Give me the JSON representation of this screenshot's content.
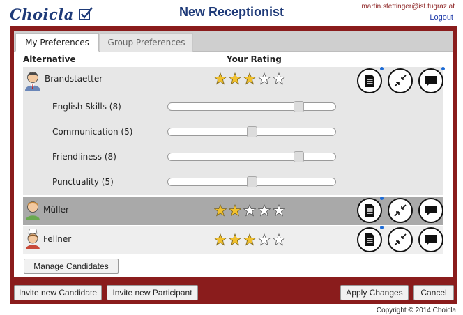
{
  "header": {
    "logo_text": "Choicla",
    "title": "New Receptionist",
    "user_email": "martin.stettinger@ist.tugraz.at",
    "logout_label": "Logout"
  },
  "tabs": [
    {
      "label": "My Preferences",
      "active": true
    },
    {
      "label": "Group Preferences",
      "active": false
    }
  ],
  "columns": {
    "alternative": "Alternative",
    "rating": "Your Rating"
  },
  "candidates": [
    {
      "name": "Brandstaetter",
      "rating": 3,
      "expanded": true
    },
    {
      "name": "Müller",
      "rating": 2,
      "selected": true
    },
    {
      "name": "Fellner",
      "rating": 3
    }
  ],
  "criteria": [
    {
      "label": "English Skills (8)",
      "value": 8
    },
    {
      "label": "Communication (5)",
      "value": 5
    },
    {
      "label": "Friendliness (8)",
      "value": 8
    },
    {
      "label": "Punctuality (5)",
      "value": 5
    }
  ],
  "buttons": {
    "manage_candidates": "Manage Candidates",
    "invite_candidate": "Invite new Candidate",
    "invite_participant": "Invite new Participant",
    "apply_changes": "Apply Changes",
    "cancel": "Cancel"
  },
  "footer": {
    "copyright": "Copyright © 2014 Choicla"
  },
  "colors": {
    "frame": "#8a1c1c",
    "title": "#1e3a78",
    "star_filled": "#f2c12e",
    "selected_row": "#a9a9a9"
  },
  "icons": [
    "checkbox-icon",
    "star-icon",
    "document-icon",
    "compress-icon",
    "comment-icon",
    "person-icon"
  ]
}
